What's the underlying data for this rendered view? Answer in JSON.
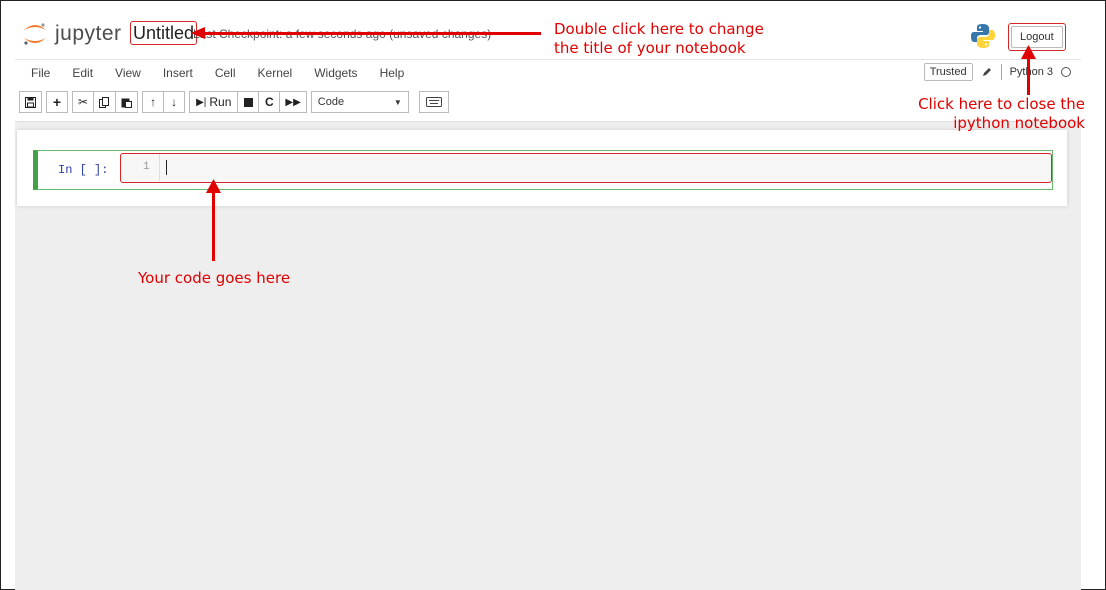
{
  "header": {
    "brand": "jupyter",
    "title": "Untitled",
    "checkpoint": "Last Checkpoint: a few seconds ago  (unsaved changes)",
    "logout_label": "Logout"
  },
  "menubar": {
    "items": [
      "File",
      "Edit",
      "View",
      "Insert",
      "Cell",
      "Kernel",
      "Widgets",
      "Help"
    ],
    "trusted_label": "Trusted",
    "kernel_name": "Python 3"
  },
  "toolbar": {
    "run_label": "Run",
    "cell_type": "Code"
  },
  "cell": {
    "prompt": "In [ ]:",
    "line_number": "1"
  },
  "annotations": {
    "title_note_line1": "Double click here to change",
    "title_note_line2": "the title of your notebook",
    "logout_note_line1": "Click here to close the",
    "logout_note_line2": "ipython notebook",
    "code_note": "Your code goes here",
    "color": "#e00000"
  }
}
